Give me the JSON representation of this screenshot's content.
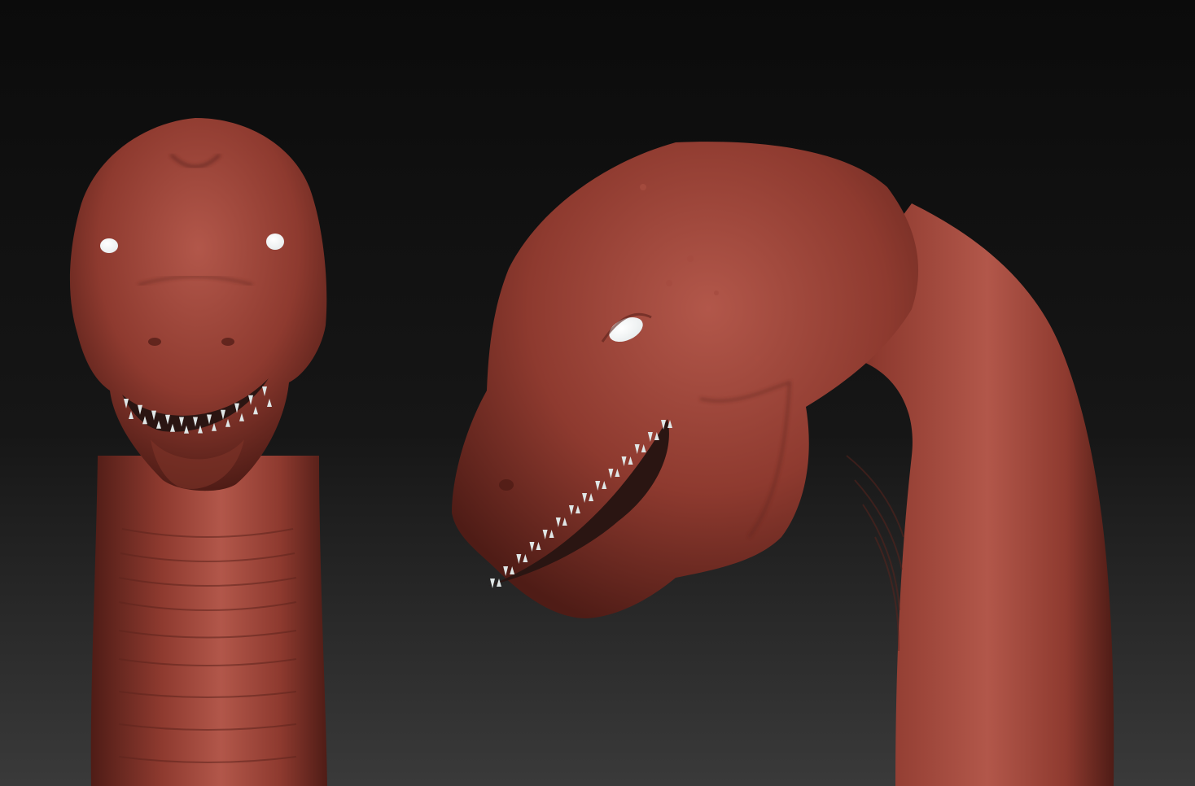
{
  "scene": {
    "background_top": "#0b0b0b",
    "background_mid": "#161616",
    "background_bottom": "#3a3a3a",
    "skin_base": "#8e3a2f",
    "skin_highlight": "#b2574a",
    "skin_shadow": "#4f1c16",
    "eye_color": "#e8eced",
    "tooth_color": "#dfe6e6",
    "mouth_interior": "#2a1512"
  },
  "views": [
    {
      "name": "front-view",
      "subject": "creature-head-front"
    },
    {
      "name": "three-quarter-view",
      "subject": "creature-head-side"
    }
  ]
}
